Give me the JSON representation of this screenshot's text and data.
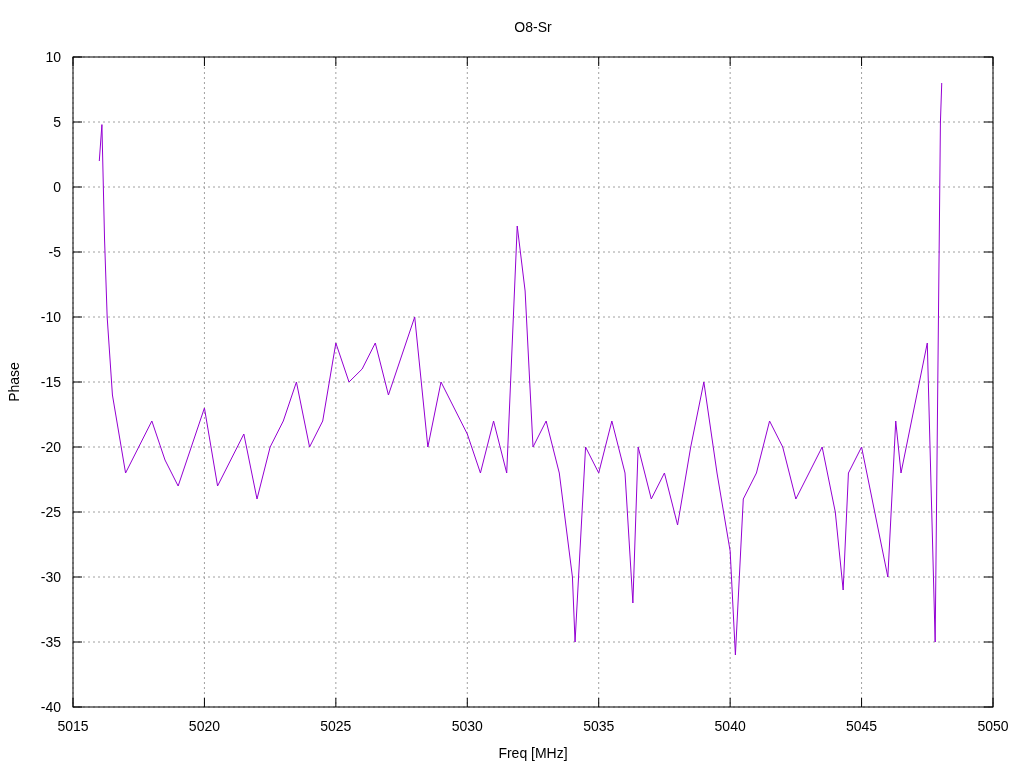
{
  "chart_data": {
    "type": "line",
    "title": "O8-Sr",
    "xlabel": "Freq [MHz]",
    "ylabel": "Phase",
    "xlim": [
      5015,
      5050
    ],
    "ylim": [
      -40,
      10
    ],
    "xticks": [
      5015,
      5020,
      5025,
      5030,
      5035,
      5040,
      5045,
      5050
    ],
    "yticks": [
      -40,
      -35,
      -30,
      -25,
      -20,
      -15,
      -10,
      -5,
      0,
      5,
      10
    ],
    "x": [
      5016,
      5016.1,
      5016.2,
      5016.3,
      5016.5,
      5017,
      5017.5,
      5018,
      5018.5,
      5019,
      5019.5,
      5020,
      5020.5,
      5021,
      5021.5,
      5022,
      5022.5,
      5023,
      5023.5,
      5024,
      5024.5,
      5025,
      5025.5,
      5026,
      5026.5,
      5027,
      5027.5,
      5028,
      5028.5,
      5029,
      5029.5,
      5030,
      5030.5,
      5031,
      5031.5,
      5031.9,
      5032.2,
      5032.5,
      5033,
      5033.5,
      5034,
      5034.1,
      5034.5,
      5035,
      5035.5,
      5036,
      5036.3,
      5036.5,
      5037,
      5037.5,
      5038,
      5038.5,
      5039,
      5039.5,
      5040,
      5040.2,
      5040.5,
      5041,
      5041.5,
      5042,
      5042.5,
      5043,
      5043.5,
      5044,
      5044.3,
      5044.5,
      5045,
      5045.5,
      5046,
      5046.3,
      5046.5,
      5047,
      5047.5,
      5047.8,
      5048,
      5048.05
    ],
    "grid": true,
    "series": [
      {
        "color": "#9400d3",
        "values": [
          2,
          4.8,
          -4,
          -10,
          -16,
          -22,
          -20,
          -18,
          -21,
          -23,
          -20,
          -17,
          -23,
          -21,
          -19,
          -24,
          -20,
          -18,
          -15,
          -20,
          -18,
          -12,
          -15,
          -14,
          -12,
          -16,
          -13,
          -10,
          -20,
          -15,
          -17,
          -19,
          -22,
          -18,
          -22,
          -3,
          -8,
          -20,
          -18,
          -22,
          -30,
          -35,
          -20,
          -22,
          -18,
          -22,
          -32,
          -20,
          -24,
          -22,
          -26,
          -20,
          -15,
          -22,
          -28,
          -36,
          -24,
          -22,
          -18,
          -20,
          -24,
          -22,
          -20,
          -25,
          -31,
          -22,
          -20,
          -25,
          -30,
          -18,
          -22,
          -17,
          -12,
          -35,
          5,
          8
        ]
      }
    ]
  }
}
